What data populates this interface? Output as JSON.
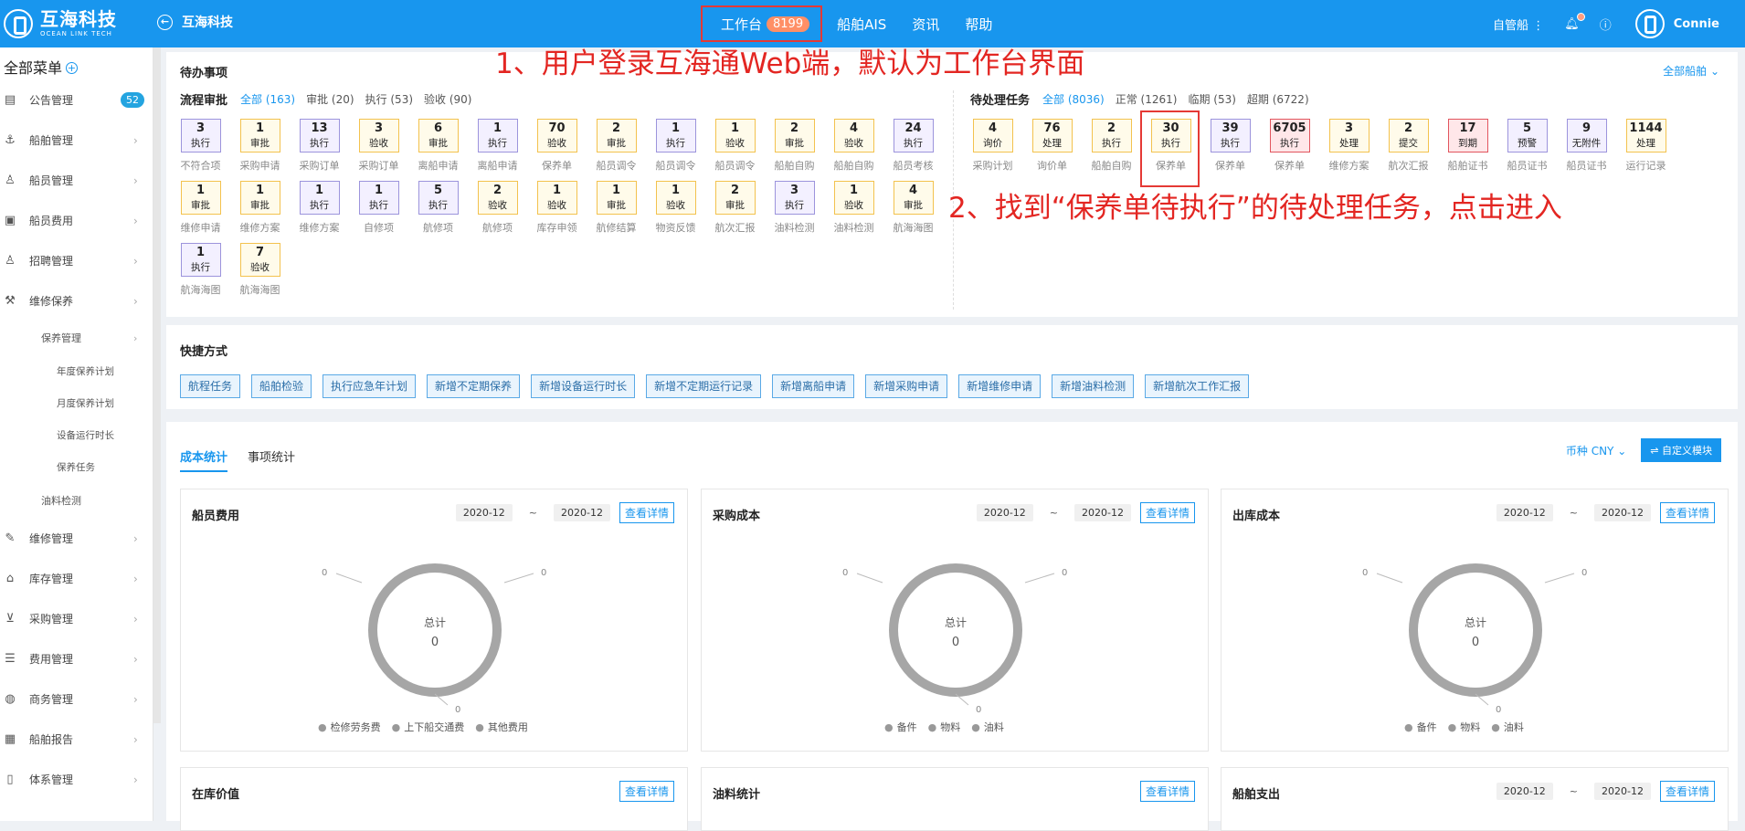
{
  "header": {
    "logo_cn": "互海科技",
    "logo_en": "OCEAN LINK TECH",
    "back_label": "互海科技",
    "nav": [
      {
        "label": "工作台",
        "badge": "8199"
      },
      {
        "label": "船舶AIS"
      },
      {
        "label": "资讯"
      },
      {
        "label": "帮助"
      }
    ],
    "ship_filter": "自管船",
    "user": "Connie"
  },
  "sidebar": {
    "title": "全部菜单",
    "items": [
      {
        "label": "公告管理",
        "badge": "52",
        "icon": "announcement-icon"
      },
      {
        "label": "船舶管理",
        "icon": "anchor-icon"
      },
      {
        "label": "船员管理",
        "icon": "crew-icon"
      },
      {
        "label": "船员费用",
        "icon": "wallet-icon"
      },
      {
        "label": "招聘管理",
        "icon": "recruit-icon"
      },
      {
        "label": "维修保养",
        "icon": "wrench-icon"
      }
    ],
    "sub": {
      "label": "保养管理",
      "children": [
        "年度保养计划",
        "月度保养计划",
        "设备运行时长",
        "保养任务"
      ]
    },
    "sub2": "油料检测",
    "items2": [
      {
        "label": "维修管理",
        "icon": "tool-icon"
      },
      {
        "label": "库存管理",
        "icon": "warehouse-icon"
      },
      {
        "label": "采购管理",
        "icon": "cart-icon"
      },
      {
        "label": "费用管理",
        "icon": "coins-icon"
      },
      {
        "label": "商务管理",
        "icon": "globe-icon"
      },
      {
        "label": "船舶报告",
        "icon": "report-icon"
      },
      {
        "label": "体系管理",
        "icon": "document-icon"
      }
    ]
  },
  "todo": {
    "title": "待办事项",
    "all_ships": "全部船舶",
    "approval": {
      "title": "流程审批",
      "tabs": [
        "全部 (163)",
        "审批 (20)",
        "执行 (53)",
        "验收 (90)"
      ],
      "items": [
        {
          "n": "3",
          "t": "执行",
          "l": "不符合项",
          "c": "purple"
        },
        {
          "n": "1",
          "t": "审批",
          "l": "采购申请",
          "c": "yellow"
        },
        {
          "n": "13",
          "t": "执行",
          "l": "采购订单",
          "c": "purple"
        },
        {
          "n": "3",
          "t": "验收",
          "l": "采购订单",
          "c": "yellow"
        },
        {
          "n": "6",
          "t": "审批",
          "l": "离船申请",
          "c": "yellow"
        },
        {
          "n": "1",
          "t": "执行",
          "l": "离船申请",
          "c": "purple"
        },
        {
          "n": "70",
          "t": "验收",
          "l": "保养单",
          "c": "yellow"
        },
        {
          "n": "2",
          "t": "审批",
          "l": "船员调令",
          "c": "yellow"
        },
        {
          "n": "1",
          "t": "执行",
          "l": "船员调令",
          "c": "purple"
        },
        {
          "n": "1",
          "t": "验收",
          "l": "船员调令",
          "c": "yellow"
        },
        {
          "n": "2",
          "t": "审批",
          "l": "船舶自购",
          "c": "yellow"
        },
        {
          "n": "4",
          "t": "验收",
          "l": "船舶自购",
          "c": "yellow"
        },
        {
          "n": "24",
          "t": "执行",
          "l": "船员考核",
          "c": "purple"
        },
        {
          "n": "1",
          "t": "审批",
          "l": "维修申请",
          "c": "yellow"
        },
        {
          "n": "1",
          "t": "审批",
          "l": "维修方案",
          "c": "yellow"
        },
        {
          "n": "1",
          "t": "执行",
          "l": "维修方案",
          "c": "purple"
        },
        {
          "n": "1",
          "t": "执行",
          "l": "自修项",
          "c": "purple"
        },
        {
          "n": "5",
          "t": "执行",
          "l": "航修项",
          "c": "purple"
        },
        {
          "n": "2",
          "t": "验收",
          "l": "航修项",
          "c": "yellow"
        },
        {
          "n": "1",
          "t": "验收",
          "l": "库存申领",
          "c": "yellow"
        },
        {
          "n": "1",
          "t": "审批",
          "l": "航修结算",
          "c": "yellow"
        },
        {
          "n": "1",
          "t": "验收",
          "l": "物资反馈",
          "c": "yellow"
        },
        {
          "n": "2",
          "t": "审批",
          "l": "航次汇报",
          "c": "yellow"
        },
        {
          "n": "3",
          "t": "执行",
          "l": "油料检测",
          "c": "purple"
        },
        {
          "n": "1",
          "t": "验收",
          "l": "油料检测",
          "c": "yellow"
        },
        {
          "n": "4",
          "t": "审批",
          "l": "航海海图",
          "c": "yellow"
        },
        {
          "n": "1",
          "t": "执行",
          "l": "航海海图",
          "c": "purple"
        },
        {
          "n": "7",
          "t": "验收",
          "l": "航海海图",
          "c": "yellow"
        }
      ]
    },
    "pending": {
      "title": "待处理任务",
      "tabs": [
        "全部 (8036)",
        "正常 (1261)",
        "临期 (53)",
        "超期 (6722)"
      ],
      "items": [
        {
          "n": "4",
          "t": "询价",
          "l": "采购计划",
          "c": "yellow"
        },
        {
          "n": "76",
          "t": "处理",
          "l": "询价单",
          "c": "yellow"
        },
        {
          "n": "2",
          "t": "执行",
          "l": "船舶自购",
          "c": "yellow"
        },
        {
          "n": "30",
          "t": "执行",
          "l": "保养单",
          "c": "yellow"
        },
        {
          "n": "39",
          "t": "执行",
          "l": "保养单",
          "c": "purple"
        },
        {
          "n": "6705",
          "t": "执行",
          "l": "保养单",
          "c": "red"
        },
        {
          "n": "3",
          "t": "处理",
          "l": "维修方案",
          "c": "yellow"
        },
        {
          "n": "2",
          "t": "提交",
          "l": "航次汇报",
          "c": "yellow"
        },
        {
          "n": "17",
          "t": "到期",
          "l": "船舶证书",
          "c": "red"
        },
        {
          "n": "5",
          "t": "预警",
          "l": "船员证书",
          "c": "purple"
        },
        {
          "n": "9",
          "t": "无附件",
          "l": "船员证书",
          "c": "purple"
        },
        {
          "n": "1144",
          "t": "处理",
          "l": "运行记录",
          "c": "yellow"
        }
      ]
    }
  },
  "annotations": {
    "a1": "1、用户登录互海通Web端，默认为工作台界面",
    "a2": "2、找到“保养单待执行”的待处理任务，点击进入"
  },
  "shortcuts": {
    "title": "快捷方式",
    "items": [
      "航程任务",
      "船舶检验",
      "执行应急年计划",
      "新增不定期保养",
      "新增设备运行时长",
      "新增不定期运行记录",
      "新增离船申请",
      "新增采购申请",
      "新增维修申请",
      "新增油料检测",
      "新增航次工作汇报"
    ]
  },
  "stats": {
    "tabs": [
      "成本统计",
      "事项统计"
    ],
    "currency": "币种 CNY",
    "custom": "自定义模块",
    "panels": [
      {
        "title": "船员费用",
        "from": "2020-12",
        "to": "2020-12",
        "detail": "查看详情",
        "total_label": "总计",
        "total": "0",
        "legend": [
          "检修劳务费",
          "上下船交通费",
          "其他费用"
        ],
        "zero": "0"
      },
      {
        "title": "采购成本",
        "from": "2020-12",
        "to": "2020-12",
        "detail": "查看详情",
        "total_label": "总计",
        "total": "0",
        "legend": [
          "备件",
          "物料",
          "油料"
        ],
        "zero": "0"
      },
      {
        "title": "出库成本",
        "from": "2020-12",
        "to": "2020-12",
        "detail": "查看详情",
        "total_label": "总计",
        "total": "0",
        "legend": [
          "备件",
          "物料",
          "油料"
        ],
        "zero": "0"
      }
    ],
    "bottom": [
      {
        "title": "在库价值",
        "detail": "查看详情"
      },
      {
        "title": "油料统计",
        "detail": "查看详情"
      },
      {
        "title": "船舶支出",
        "from": "2020-12",
        "to": "2020-12",
        "detail": "查看详情"
      }
    ]
  }
}
